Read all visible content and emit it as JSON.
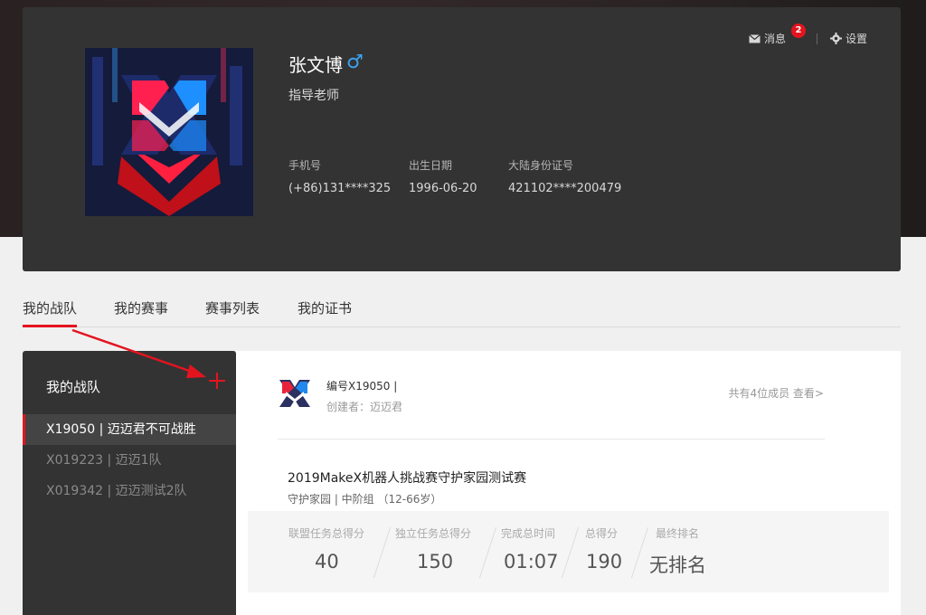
{
  "profile": {
    "name": "张文博",
    "gender_symbol": "♂",
    "role": "指导老师",
    "fields": [
      {
        "label": "手机号",
        "value": "(+86)131****325"
      },
      {
        "label": "出生日期",
        "value": "1996-06-20"
      },
      {
        "label": "大陆身份证号",
        "value": "421102****200479"
      }
    ]
  },
  "top_actions": {
    "messages_label": "消息",
    "messages_count": "2",
    "settings_label": "设置"
  },
  "tabs": [
    {
      "label": "我的战队"
    },
    {
      "label": "我的赛事"
    },
    {
      "label": "赛事列表"
    },
    {
      "label": "我的证书"
    }
  ],
  "sidebar": {
    "title": "我的战队",
    "teams": [
      {
        "label": "X19050 | 迈迈君不可战胜"
      },
      {
        "label": "X019223 | 迈迈1队"
      },
      {
        "label": "X019342 | 迈迈测试2队"
      }
    ]
  },
  "team_detail": {
    "number": "编号X19050 |",
    "creator": "创建者：迈迈君",
    "members_info": "共有4位成员  查看>",
    "match_title": "2019MakeX机器人挑战赛守护家园测试赛",
    "match_meta": "守护家园 | 中阶组  （12-66岁）",
    "stats": [
      {
        "label": "联盟任务总得分",
        "value": "40"
      },
      {
        "label": "独立任务总得分",
        "value": "150"
      },
      {
        "label": "完成总时间",
        "value": "01:07"
      },
      {
        "label": "总得分",
        "value": "190"
      },
      {
        "label": "最终排名",
        "value": "无排名"
      }
    ]
  },
  "colors": {
    "accent": "#e4141f",
    "dark_panel": "#333333",
    "gender_blue": "#3da5f5"
  }
}
